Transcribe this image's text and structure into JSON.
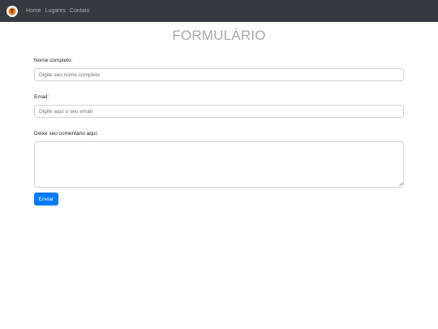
{
  "navbar": {
    "logo_icon": "orange-logo-icon",
    "links": [
      "Home",
      "Lugares",
      "Contato"
    ],
    "background": "#343a40"
  },
  "form": {
    "title": "FORMULÁRIO",
    "name": {
      "label": "Nome completo:",
      "placeholder": "Digite seu nome completo",
      "value": ""
    },
    "email": {
      "label": "Email:",
      "placeholder": "Digite aqui o seu email",
      "value": ""
    },
    "comment": {
      "label": "Deixe seu comentário aqui:",
      "value": ""
    },
    "submit_label": "Enviar",
    "accent_color": "#007bff"
  }
}
